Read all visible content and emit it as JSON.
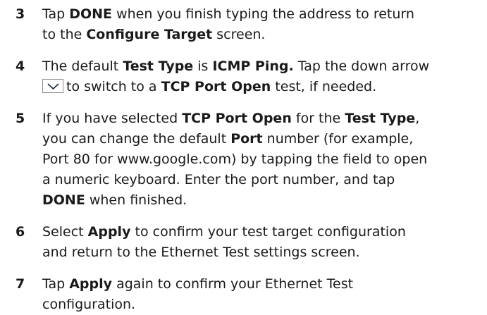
{
  "steps": [
    {
      "number": "3",
      "lines": [
        [
          "Tap ",
          "DONE",
          " when you finish typing the address to return"
        ],
        [
          "to the ",
          "Configure Target",
          " screen."
        ]
      ]
    },
    {
      "number": "4",
      "line1": [
        "The default ",
        "Test Type",
        " is ",
        "ICMP Ping.",
        " Tap the down arrow"
      ],
      "line2": [
        "to switch to a ",
        "TCP Port Open",
        " test, if needed."
      ],
      "icon": "chevron-down-icon"
    },
    {
      "number": "5",
      "line1": [
        "If you have selected ",
        "TCP Port Open",
        " for the ",
        "Test Type",
        ","
      ],
      "line2": [
        "you can change the default ",
        "Port",
        " number (for example,"
      ],
      "line3": "Port 80 for www.google.com) by tapping the field to open",
      "line4": "a numeric keyboard. Enter the port number, and tap",
      "line5": [
        "DONE",
        " when finished."
      ]
    },
    {
      "number": "6",
      "line1": [
        "Select ",
        "Apply",
        " to confirm your test target configuration"
      ],
      "line2": "and return to the Ethernet Test settings screen."
    },
    {
      "number": "7",
      "line1": [
        "Tap ",
        "Apply",
        " again to confirm your Ethernet Test"
      ],
      "line2": "configuration."
    }
  ]
}
